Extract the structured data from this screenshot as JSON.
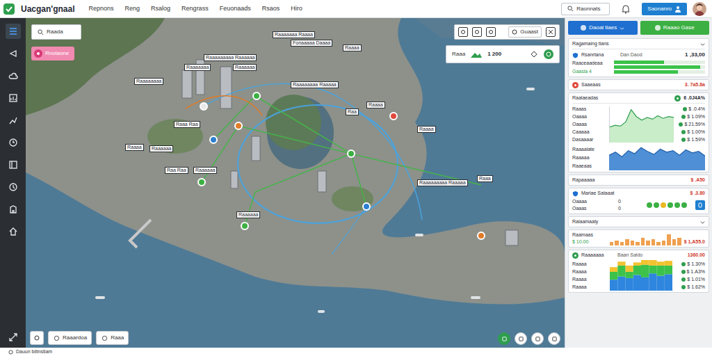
{
  "app": {
    "title": "Uacgan'gnaal"
  },
  "nav": [
    "Repnons",
    "Reng",
    "Rsalog",
    "Rengrass",
    "Feuonaads",
    "Rsaos",
    "Hiro"
  ],
  "header": {
    "search_label": "Raonnats",
    "button": "Saonanro"
  },
  "sidebar": [
    {
      "selected": true
    },
    {
      "selected": false
    },
    {
      "selected": false
    },
    {
      "selected": false
    },
    {
      "selected": false
    },
    {
      "selected": false
    },
    {
      "selected": false
    },
    {
      "selected": false
    },
    {
      "selected": false
    },
    {
      "selected": false
    }
  ],
  "map": {
    "search": "Raada",
    "chip": "Rnolaone",
    "tool_label": "Guaast",
    "stat": {
      "label": "Raaa",
      "value": "1 200"
    },
    "labels": [
      "Raaaaaaa Raaaa",
      "Fonaaaaa Daaaa",
      "Raaaaaaaaa Raaaaaa",
      "Raaaa",
      "Raaaaaaa",
      "Raaaaaa",
      "Raaaaaaaa",
      "Raaaaaaaa Raaaaa",
      "Raaaa",
      "Raa",
      "Raaa Raa",
      "Raaaa",
      "Raaaa",
      "Raaaaaa",
      "Raa Raa",
      "Raaaaaa",
      "Raaaaaaaaa Raaaaa",
      "Raaa",
      "Raaaaaa"
    ],
    "pins": [
      {
        "color": "#e8e8e8"
      },
      {
        "color": "#2e7fd0"
      },
      {
        "color": "#3cb043"
      },
      {
        "color": "#e07b28"
      },
      {
        "color": "#3cb043"
      },
      {
        "color": "#2e7fd0"
      },
      {
        "color": "#e04a3c"
      },
      {
        "color": "#e07b28"
      },
      {
        "color": "#3cb043"
      },
      {
        "color": "#3cb043"
      }
    ],
    "buttons": [
      "Raaardoa",
      "Raaa"
    ]
  },
  "panel": {
    "buttons": [
      {
        "label": "Daoal tiaes",
        "color": "#1e6fd0"
      },
      {
        "label": "Raaao Gase",
        "color": "#3cb043"
      }
    ],
    "title": "Ragamaing tians",
    "summary": {
      "name": "Rsanrtana",
      "sub": "Dan Daod",
      "value": "1 ,33,00",
      "label": "Raaceaadeaa",
      "item": "Gaasla 4",
      "levels": [
        0.55,
        0.95,
        0.7
      ]
    },
    "alert": {
      "name": "Saaeaas",
      "value": "3. 7a5.8a"
    },
    "rates": {
      "title": "Raalaeadas",
      "value": "6 .0J4A%",
      "rows": [
        {
          "name": "Raaas",
          "value": "$ .0.4%"
        },
        {
          "name": "Oaaaa",
          "value": "$ 1.09%"
        },
        {
          "name": "Oaaaa",
          "value": "$ 21.59%"
        },
        {
          "name": "Caaaaa",
          "value": "$ 1.00%"
        },
        {
          "name": "Dasaaaar",
          "value": "$ 1.59%"
        }
      ],
      "series": [
        18,
        20,
        19,
        24,
        38,
        30,
        26,
        29,
        27,
        31,
        28,
        30,
        29
      ]
    },
    "flows": {
      "rows": [
        "Raaaalate",
        "Raaaaa",
        "Raaeaas"
      ],
      "series": [
        20,
        24,
        18,
        26,
        22,
        30,
        25,
        21,
        28,
        24,
        26,
        20,
        27,
        23,
        25,
        19
      ]
    },
    "total": {
      "name": "Rapaaaaa",
      "value": "$ .A50"
    },
    "marine": {
      "name": "Mariae Sataaat",
      "value": "$ .3.80",
      "rows": [
        {
          "name": "Oaaaa",
          "value": "0"
        },
        {
          "name": "Oaaas",
          "value": "0"
        }
      ],
      "dots": [
        {
          "color": "#3cb043"
        },
        {
          "color": "#3cb043"
        },
        {
          "color": "#e8b923"
        },
        {
          "color": "#3cb043"
        },
        {
          "color": "#3cb043"
        },
        {
          "color": "#3cb043"
        }
      ]
    },
    "section": "Ralaamaaty",
    "revenue": {
      "name": "Raamaas",
      "value": "$ 1,A55.0",
      "sub": "$ 10.00",
      "series": [
        3,
        4,
        3,
        5,
        4,
        3,
        6,
        4,
        5,
        3,
        4,
        9,
        5,
        6
      ]
    },
    "balance": {
      "name": "Raaaaaaa",
      "sub": "Baan Saldo",
      "value": "1360.00",
      "rows": [
        {
          "name": "Raaaa",
          "value": "$ 1.30%"
        },
        {
          "name": "Raaaa",
          "value": "$ 1.A3%"
        },
        {
          "name": "Raaaa",
          "value": "$ 1.01%"
        },
        {
          "name": "Raaaa",
          "value": "$ 1.62%"
        }
      ],
      "green": [
        10,
        14,
        8,
        12,
        16,
        10,
        13,
        11
      ],
      "yellow": [
        6,
        5,
        8,
        4,
        6,
        7,
        5,
        6
      ],
      "blue": [
        14,
        18,
        16,
        20,
        17,
        22,
        19,
        21
      ]
    }
  },
  "footer": "Dauun biitnstiam"
}
